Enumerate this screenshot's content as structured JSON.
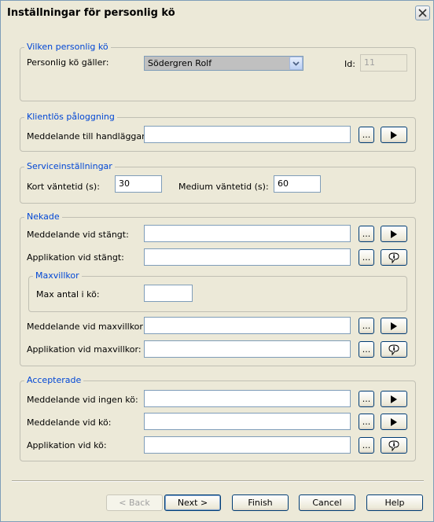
{
  "window": {
    "title": "Inställningar för personlig kö"
  },
  "groups": {
    "personal_queue": {
      "legend": "Vilken personlig kö",
      "queue_label": "Personlig kö gäller:",
      "queue_value": "Södergren Rolf",
      "id_label": "Id:",
      "id_value": "11"
    },
    "clientless": {
      "legend": "Klientlös påloggning",
      "message_label": "Meddelande till handläggare:",
      "message_value": ""
    },
    "service": {
      "legend": "Serviceinställningar",
      "short_label": "Kort väntetid (s):",
      "short_value": "30",
      "medium_label": "Medium väntetid (s):",
      "medium_value": "60"
    },
    "denied": {
      "legend": "Nekade",
      "msg_closed_label": "Meddelande vid stängt:",
      "app_closed_label": "Applikation vid stängt:",
      "maxvillkor": {
        "legend": "Maxvillkor",
        "max_label": "Max antal i kö:",
        "max_value": ""
      },
      "msg_max_label": "Meddelande vid maxvillkor:",
      "app_max_label": "Applikation vid maxvillkor:"
    },
    "accepted": {
      "legend": "Accepterade",
      "msg_noqueue_label": "Meddelande vid ingen kö:",
      "msg_queue_label": "Meddelande vid kö:",
      "app_queue_label": "Applikation vid kö:"
    }
  },
  "browse_label": "...",
  "buttons": {
    "back_label": "< Back",
    "next_label": "Next >",
    "finish_label": "Finish",
    "cancel_label": "Cancel",
    "help_label": "Help"
  },
  "icons": {
    "close": "close-icon",
    "dropdown": "chevron-down-icon",
    "play": "play-icon",
    "application": "info-bubble-icon"
  }
}
